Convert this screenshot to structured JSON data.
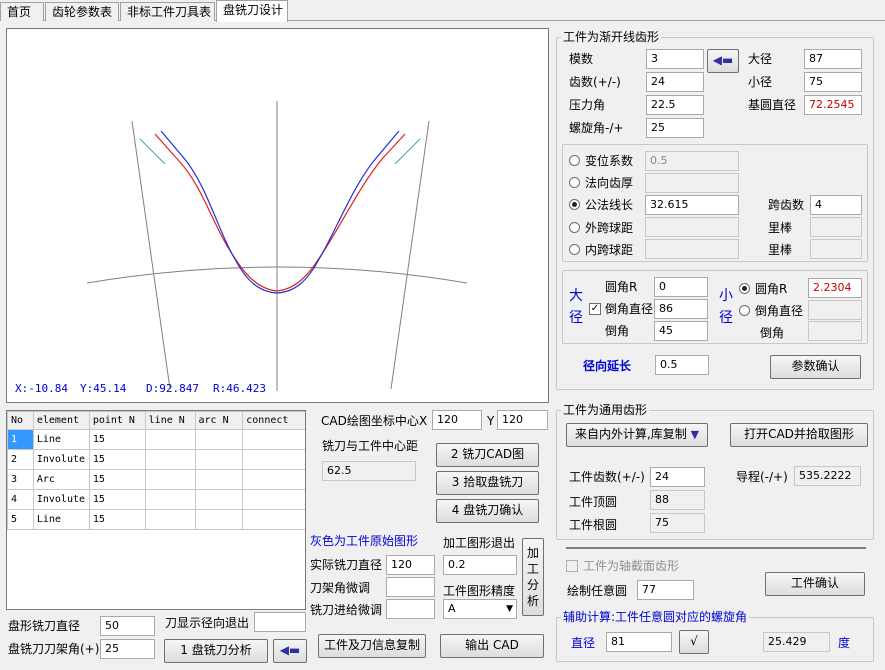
{
  "tabs": [
    {
      "label": "首页"
    },
    {
      "label": "齿轮参数表"
    },
    {
      "label": "非标工件刀具表"
    },
    {
      "label": "盘铣刀设计"
    }
  ],
  "canvas": {
    "status": {
      "x": "X:-10.84",
      "y": "Y:45.14",
      "d": "D:92.847",
      "r": "R:46.423"
    }
  },
  "table": {
    "headers": [
      "No",
      "element",
      "point N",
      "line N",
      "arc N",
      "connect"
    ],
    "rows": [
      [
        "1",
        "Line",
        "15"
      ],
      [
        "2",
        "Involute",
        "15"
      ],
      [
        "3",
        "Arc",
        "15"
      ],
      [
        "4",
        "Involute",
        "15"
      ],
      [
        "5",
        "Line",
        "15"
      ]
    ]
  },
  "cad": {
    "center_label": "CAD绘图坐标中心",
    "x_label": "X",
    "x_value": "120",
    "y_label": "Y",
    "y_value": "120",
    "dist_label": "铣刀与工件中心距",
    "dist_value": "62.5",
    "btn_cad": "2  铣刀CAD图",
    "btn_pick": "3 拾取盘铣刀",
    "btn_confirm": "4 盘铣刀确认"
  },
  "proc": {
    "gray_note": "灰色为工件原始图形",
    "exit_label": "加工图形退出",
    "exit_value": "0.2",
    "actual_dia_label": "实际铣刀直径",
    "actual_dia_value": "120",
    "holder_angle_label": "刀架角微调",
    "feed_label": "铣刀进给微调",
    "precision_label": "工件图形精度",
    "precision_value": "A",
    "analyze_label": "加工分析"
  },
  "bottom": {
    "cutter_dia_label": "盘形铣刀直径",
    "cutter_dia_value": "50",
    "radial_exit_label": "刀显示径向退出",
    "holder_angle_label": "盘铣刀刀架角(+)",
    "holder_angle_value": "25",
    "btn_analyze": "1 盘铣刀分析",
    "btn_copy": "工件及刀信息复制",
    "btn_output": "输出 CAD"
  },
  "involute": {
    "title": "工件为渐开线齿形",
    "module_label": "模数",
    "module_value": "3",
    "outer_dia_label": "大径",
    "outer_dia_value": "87",
    "teeth_label": "齿数(+/-)",
    "teeth_value": "24",
    "root_dia_label": "小径",
    "root_dia_value": "75",
    "pressure_label": "压力角",
    "pressure_value": "22.5",
    "base_dia_label": "基圆直径",
    "base_dia_value": "72.2545",
    "helix_label": "螺旋角-/+",
    "helix_value": "25",
    "shift_label": "变位系数",
    "shift_value": "0.5",
    "normal_thk_label": "法向齿厚",
    "wk_label": "公法线长",
    "wk_value": "32.615",
    "span_label": "跨齿数",
    "span_value": "4",
    "outer_ball_label": "外跨球距",
    "inner_ball_label": "内跨球距",
    "pin_label": "里棒",
    "large_label": "大径",
    "small_label": "小径",
    "radius_label": "圆角R",
    "large_radius_value": "0",
    "small_radius_value": "2.2304",
    "chamfer_dia_label": "倒角直径",
    "large_chamfer_dia_value": "86",
    "chamfer_label": "倒角",
    "large_chamfer_value": "45",
    "radial_ext_label": "径向延长",
    "radial_ext_value": "0.5",
    "param_confirm": "参数确认"
  },
  "general": {
    "title": "工件为通用齿形",
    "btn_import": "来自内外计算,库复制",
    "btn_open_cad": "打开CAD并拾取图形",
    "teeth_label": "工件齿数(+/-)",
    "teeth_value": "24",
    "lead_label": "导程(-/+)",
    "lead_value": "535.2222",
    "tip_label": "工件顶圆",
    "tip_value": "88",
    "root_label": "工件根圆",
    "root_value": "75",
    "axial_label": "工件为轴截面齿形",
    "draw_circle_label": "绘制任意圆",
    "draw_circle_value": "77",
    "confirm": "工件确认",
    "aux_title": "辅助计算:工件任意圆对应的螺旋角",
    "aux_dia_label": "直径",
    "aux_dia_value": "81",
    "aux_result": "25.429",
    "aux_unit": "度"
  },
  "colors": {
    "accent": "#0000d0",
    "red": "#d00000",
    "curve_red": "#e02020",
    "curve_blue": "#2030e0",
    "curve_teal": "#40a0a0",
    "gray_line": "#808080"
  }
}
